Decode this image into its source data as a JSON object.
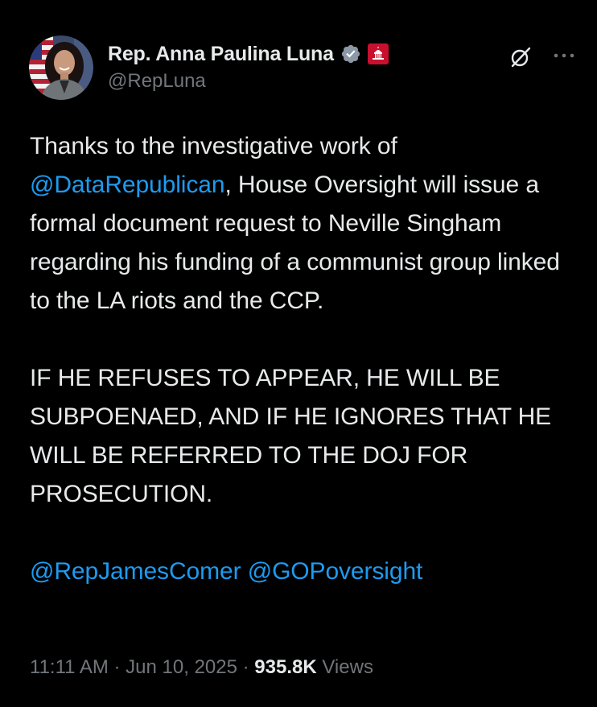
{
  "author": {
    "display_name": "Rep. Anna Paulina Luna",
    "handle": "@RepLuna",
    "verified_icon": "verified-badge-icon",
    "affiliation_icon": "us-capitol-icon",
    "verified_color": "#8b98a5",
    "affiliation_color": "#c8102e"
  },
  "toolbar": {
    "grok_icon": "grok-icon",
    "more_icon": "more-options-icon"
  },
  "tweet": {
    "p1_prefix": "Thanks to the investigative work of ",
    "mention_1": "@DataRepublican",
    "p1_suffix": ", House Oversight will issue a formal document request to Neville Singham regarding his funding of a communist group linked to the LA riots and the CCP.",
    "p2": "IF HE REFUSES TO APPEAR, HE WILL BE SUBPOENAED, AND IF HE IGNORES THAT HE WILL BE REFERRED TO THE DOJ FOR PROSECUTION.",
    "mention_2": "@RepJamesComer",
    "mention_3": "@GOPoversight"
  },
  "meta": {
    "time": "11:11 AM",
    "separator": " · ",
    "date": "Jun 10, 2025",
    "views_count": "935.8K",
    "views_label": "Views"
  },
  "colors": {
    "background": "#000000",
    "text": "#e7e9ea",
    "secondary": "#71767b",
    "link": "#1d9bf0"
  }
}
